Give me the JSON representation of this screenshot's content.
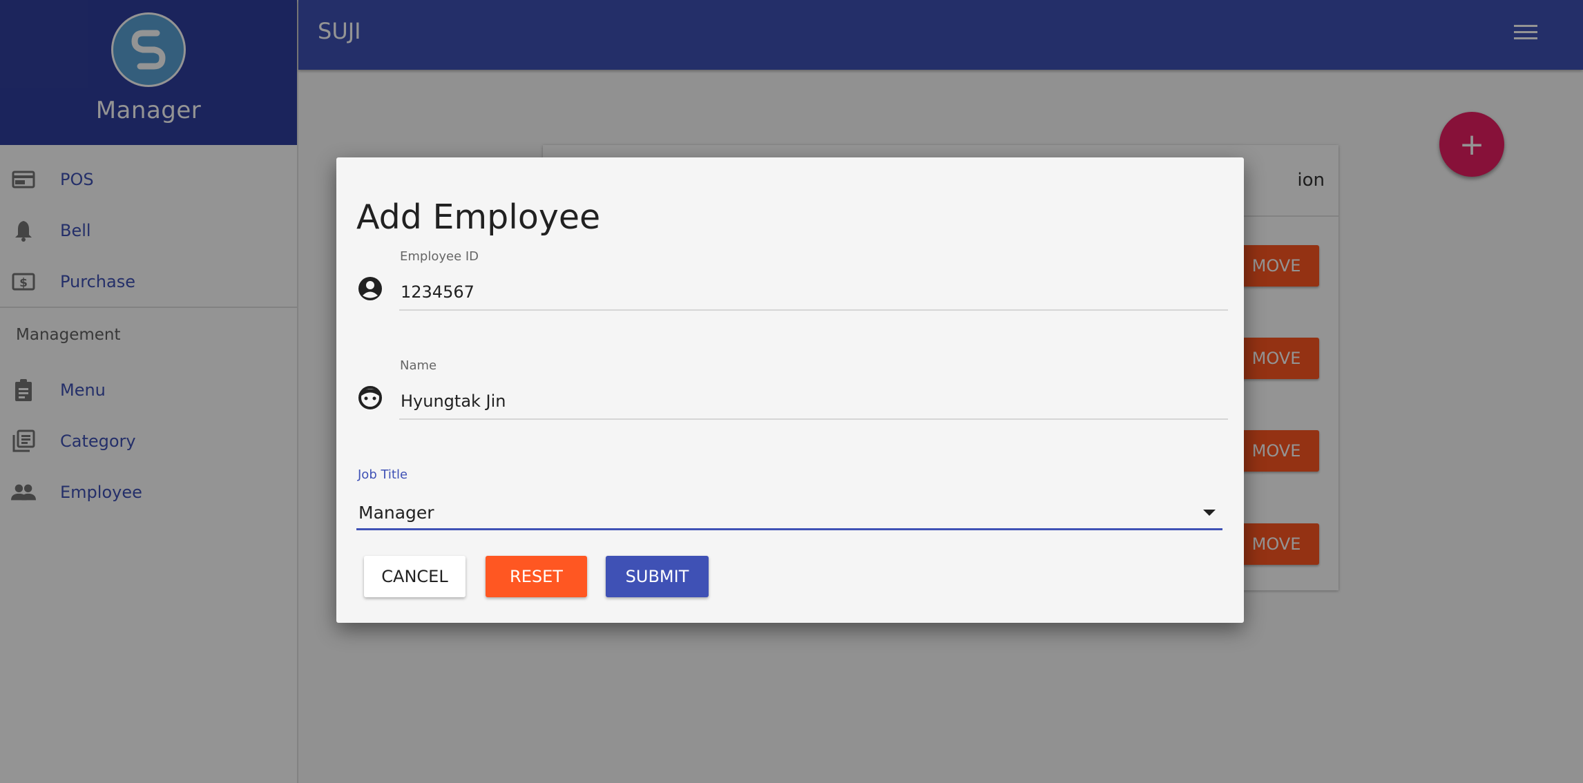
{
  "sidebar": {
    "brand": "Manager",
    "items": [
      {
        "label": "POS",
        "icon": "pos-icon"
      },
      {
        "label": "Bell",
        "icon": "bell-icon"
      },
      {
        "label": "Purchase",
        "icon": "dollar-icon"
      }
    ],
    "subheader": "Management",
    "management_items": [
      {
        "label": "Menu",
        "icon": "clipboard-icon"
      },
      {
        "label": "Category",
        "icon": "library-books-icon"
      },
      {
        "label": "Employee",
        "icon": "people-icon"
      }
    ]
  },
  "header": {
    "title": "SUJI",
    "menu_icon": "hamburger-menu-icon"
  },
  "main": {
    "fab_label": "+",
    "table": {
      "action_header": "ion",
      "remove_label": "MOVE"
    }
  },
  "dialog": {
    "title": "Add Employee",
    "employee_id": {
      "label": "Employee ID",
      "value": "1234567",
      "icon": "account-circle-icon"
    },
    "name": {
      "label": "Name",
      "value": "Hyungtak Jin",
      "icon": "face-icon"
    },
    "job_title": {
      "label": "Job Title",
      "value": "Manager"
    },
    "buttons": {
      "cancel": "CANCEL",
      "reset": "RESET",
      "submit": "SUBMIT"
    }
  },
  "colors": {
    "primary": "#3f51b5",
    "primary_dark": "#303f9f",
    "accent_pink": "#e91e63",
    "reset_orange": "#ff5722",
    "dialog_bg": "#f5f5f5"
  }
}
